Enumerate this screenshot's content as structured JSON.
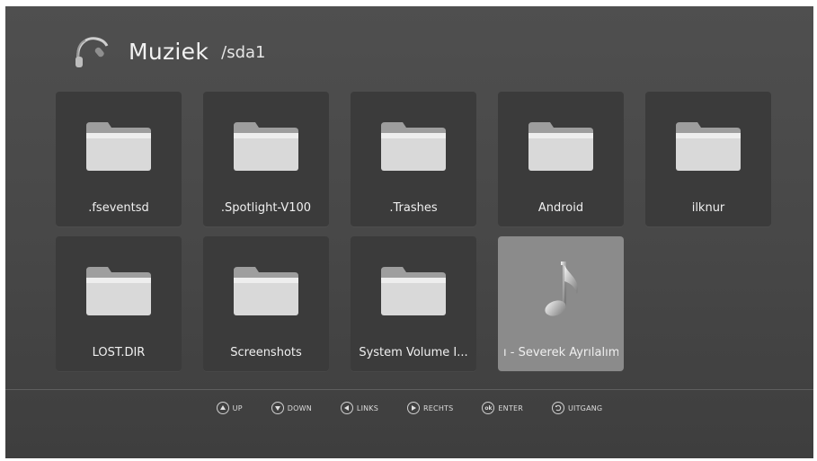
{
  "header": {
    "title": "Muziek",
    "path": "/sda1",
    "icon": "headphones-icon"
  },
  "tiles": [
    {
      "label": ".fseventsd",
      "icon": "folder-icon",
      "selected": false
    },
    {
      "label": ".Spotlight-V100",
      "icon": "folder-icon",
      "selected": false
    },
    {
      "label": ".Trashes",
      "icon": "folder-icon",
      "selected": false
    },
    {
      "label": "Android",
      "icon": "folder-icon",
      "selected": false
    },
    {
      "label": "ilknur",
      "icon": "folder-icon",
      "selected": false
    },
    {
      "label": "LOST.DIR",
      "icon": "folder-icon",
      "selected": false
    },
    {
      "label": "Screenshots",
      "icon": "folder-icon",
      "selected": false
    },
    {
      "label": "System Volume I...",
      "icon": "folder-icon",
      "selected": false
    },
    {
      "label": "ı - Severek Ayrılalım",
      "icon": "music-note-icon",
      "selected": true
    }
  ],
  "footer": {
    "up": "UP",
    "down": "DOWN",
    "links": "LINKS",
    "rechts": "RECHTS",
    "ok": "ok",
    "enter": "ENTER",
    "uitgang": "UITGANG"
  },
  "colors": {
    "background": "#4a4a4a",
    "tile": "#3b3b3b",
    "tile_selected": "#8b8b8b",
    "text": "#f0f0f0"
  }
}
